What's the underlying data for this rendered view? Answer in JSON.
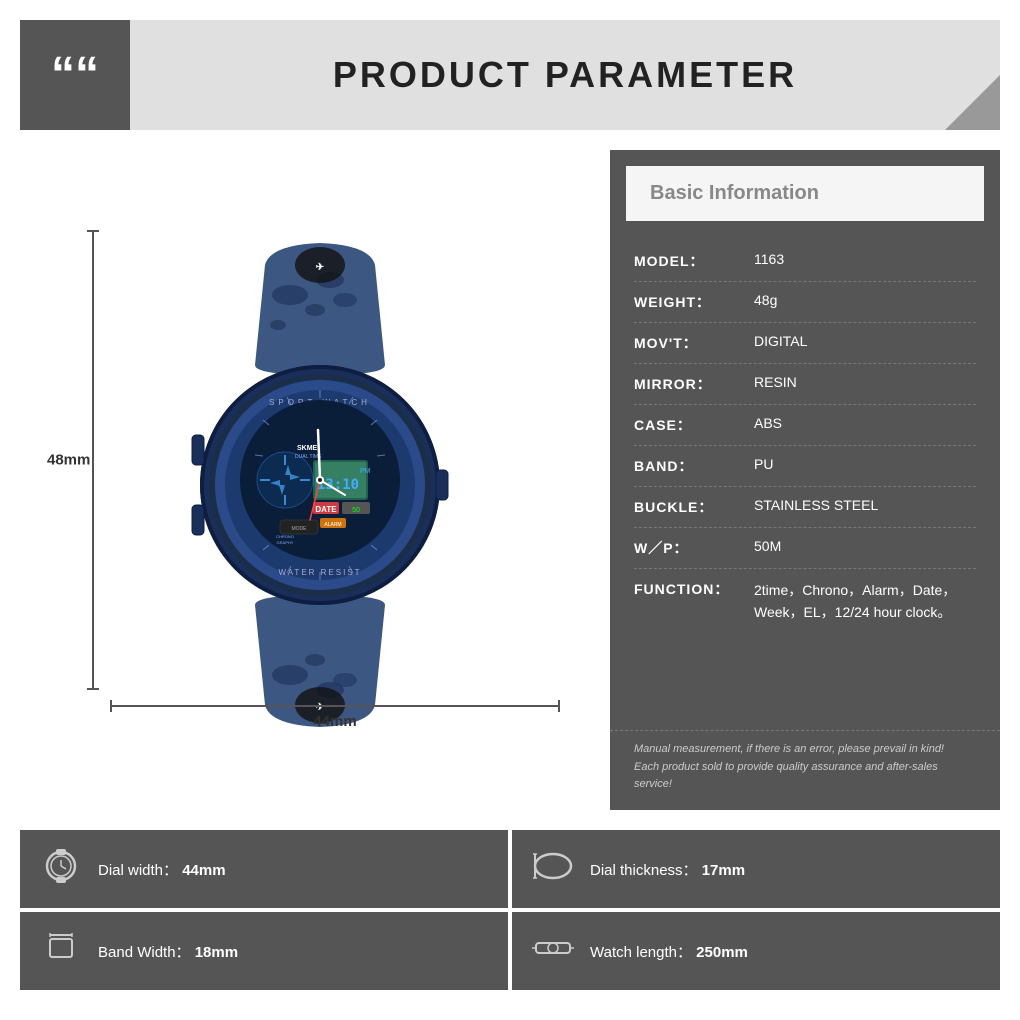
{
  "header": {
    "quote_symbol": "““",
    "title": "PRODUCT PARAMETER"
  },
  "watch": {
    "height_label": "48mm",
    "width_label": "44mm"
  },
  "info_panel": {
    "header_title": "Basic Information",
    "rows": [
      {
        "key": "MODEL：",
        "value": "1163"
      },
      {
        "key": "WEIGHT：",
        "value": "48g"
      },
      {
        "key": "MOV'T：",
        "value": "DIGITAL"
      },
      {
        "key": "MIRROR：",
        "value": "RESIN"
      },
      {
        "key": "CASE：",
        "value": "ABS"
      },
      {
        "key": "BAND：",
        "value": "PU"
      },
      {
        "key": "BUCKLE：",
        "value": "STAINLESS STEEL"
      },
      {
        "key": "W／P：",
        "value": "50M"
      },
      {
        "key": "FUNCTION：",
        "value": "2time，Chrono，Alarm，Date，Week，EL，12/24 hour clock。"
      }
    ],
    "note": "Manual measurement, if there is an error, please prevail in kind!\nEach product sold to provide quality assurance and after-sales service!"
  },
  "specs": [
    {
      "icon": "⌚",
      "label": "Dial width：",
      "value": "44mm",
      "name": "dial-width"
    },
    {
      "icon": "⊟",
      "label": "Dial thickness：",
      "value": "17mm",
      "name": "dial-thickness"
    },
    {
      "icon": "▐",
      "label": "Band Width：",
      "value": "18mm",
      "name": "band-width"
    },
    {
      "icon": "⊙",
      "label": "Watch length：",
      "value": "250mm",
      "name": "watch-length"
    }
  ]
}
